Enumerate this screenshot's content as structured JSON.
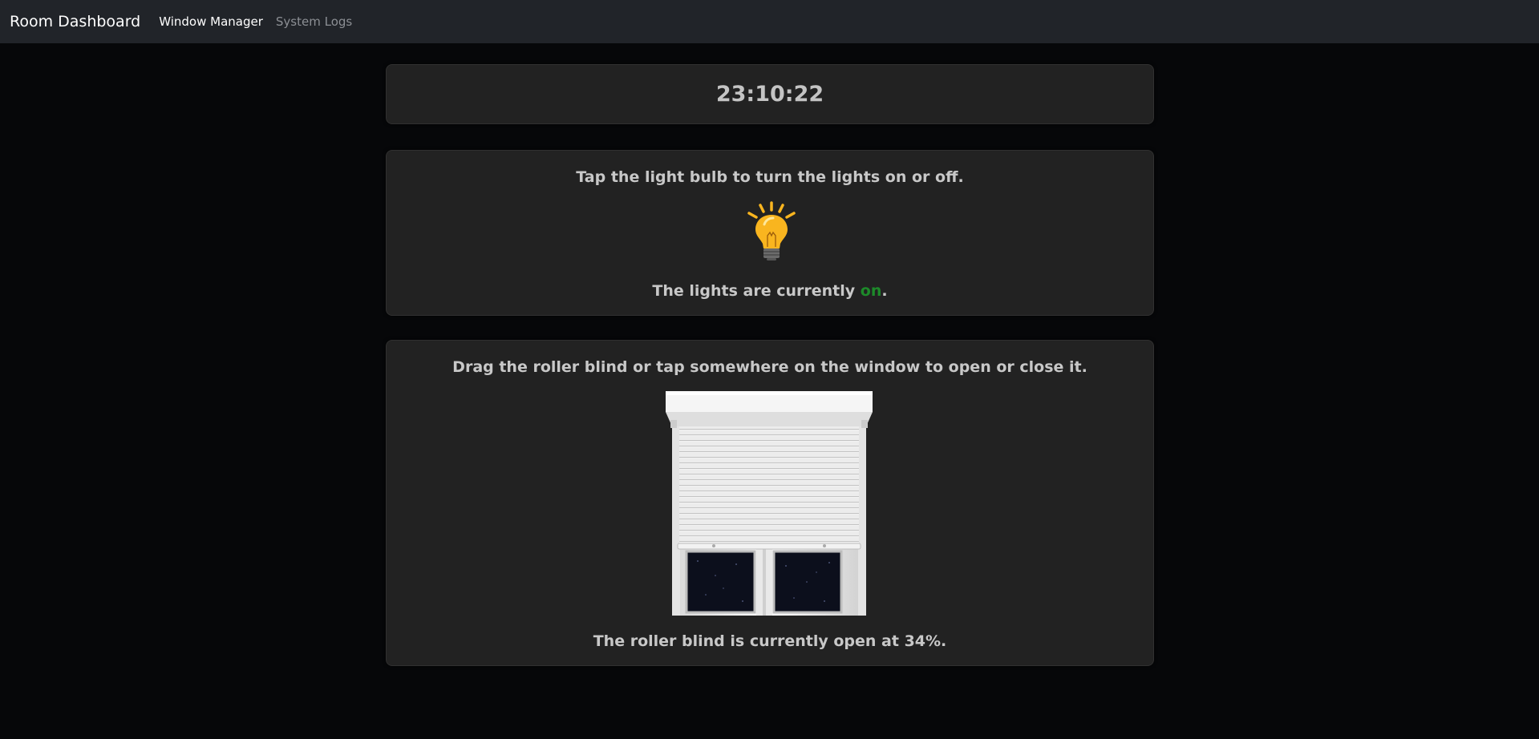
{
  "nav": {
    "brand": "Room Dashboard",
    "links": [
      {
        "label": "Window Manager",
        "active": true
      },
      {
        "label": "System Logs",
        "active": false
      }
    ]
  },
  "clock": {
    "time": "23:10:22"
  },
  "lights": {
    "instruction": "Tap the light bulb to turn the lights on or off.",
    "status_prefix": "The lights are currently ",
    "state": "on",
    "status_suffix": ".",
    "bulb_icon": "light-bulb-icon",
    "state_color": "#1d8a2a",
    "bulb_color": "#f9b51f"
  },
  "blind": {
    "instruction": "Drag the roller blind or tap somewhere on the window to open or close it.",
    "status_text": "The roller blind is currently open at 34%.",
    "open_percent": 34
  }
}
